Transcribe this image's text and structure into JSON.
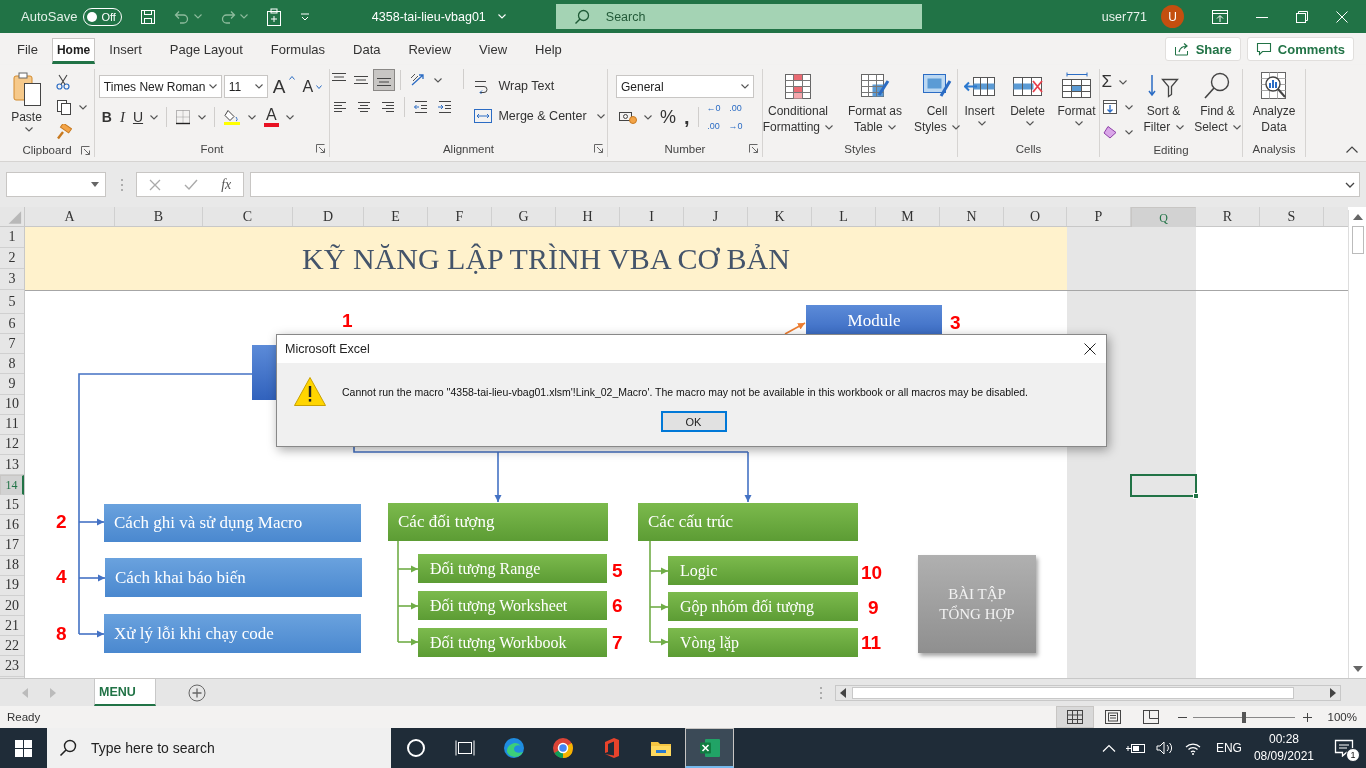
{
  "title_bar": {
    "autosave_label": "AutoSave",
    "autosave": {
      "label": "Off",
      "on": false
    },
    "file_name": "4358-tai-lieu-vbag01",
    "search_placeholder": "Search",
    "user_name": "user771",
    "avatar_initial": "U"
  },
  "ribbon_tabs": [
    {
      "label": "File",
      "selected": false
    },
    {
      "label": "Home",
      "selected": true
    },
    {
      "label": "Insert",
      "selected": false
    },
    {
      "label": "Page Layout",
      "selected": false
    },
    {
      "label": "Formulas",
      "selected": false
    },
    {
      "label": "Data",
      "selected": false
    },
    {
      "label": "Review",
      "selected": false
    },
    {
      "label": "View",
      "selected": false
    },
    {
      "label": "Help",
      "selected": false
    }
  ],
  "share_button": "Share",
  "comments_button": "Comments",
  "ribbon": {
    "clipboard": {
      "label": "Clipboard",
      "launcher": true,
      "paste": "Paste"
    },
    "font": {
      "label": "Font",
      "launcher": true,
      "font_name": "Times New Roman",
      "font_size": "11",
      "grow": "A",
      "shrink": "A",
      "bold": "B",
      "italic": "I",
      "underline": "U",
      "font_color": "A"
    },
    "alignment": {
      "label": "Alignment",
      "launcher": true,
      "vertical": [
        {
          "selected": false
        },
        {
          "selected": false
        },
        {
          "selected": true
        }
      ],
      "wrap_text": "Wrap Text",
      "merge_center": "Merge & Center"
    },
    "number": {
      "label": "Number",
      "launcher": true,
      "format": "General",
      "percent": "%",
      "comma": ",",
      "increase_decimal": [
        "←0",
        ".00"
      ],
      "decrease_decimal": [
        ".00",
        "→0"
      ]
    },
    "styles": {
      "label": "Styles",
      "buttons": [
        "Conditional Formatting",
        "Format as Table",
        "Cell Styles"
      ]
    },
    "cells": {
      "label": "Cells",
      "buttons": [
        "Insert",
        "Delete",
        "Format"
      ]
    },
    "editing": {
      "label": "Editing",
      "sum": "Σ",
      "buttons": [
        "Sort & Filter",
        "Find & Select"
      ]
    },
    "analysis": {
      "label": "Analysis",
      "buttons": [
        "Analyze Data"
      ]
    }
  },
  "formula_bar": {
    "fx": "fx"
  },
  "sheet": {
    "columns": [
      {
        "label": "A",
        "selected": false
      },
      {
        "label": "B",
        "selected": false
      },
      {
        "label": "C",
        "selected": false
      },
      {
        "label": "D",
        "selected": false
      },
      {
        "label": "E",
        "selected": false
      },
      {
        "label": "F",
        "selected": false
      },
      {
        "label": "G",
        "selected": false
      },
      {
        "label": "H",
        "selected": false
      },
      {
        "label": "I",
        "selected": false
      },
      {
        "label": "J",
        "selected": false
      },
      {
        "label": "K",
        "selected": false
      },
      {
        "label": "L",
        "selected": false
      },
      {
        "label": "M",
        "selected": false
      },
      {
        "label": "N",
        "selected": false
      },
      {
        "label": "O",
        "selected": false
      },
      {
        "label": "P",
        "selected": false
      },
      {
        "label": "Q",
        "selected": true
      },
      {
        "label": "R",
        "selected": false
      },
      {
        "label": "S",
        "selected": false
      }
    ],
    "rows": [
      {
        "label": "1",
        "selected": false
      },
      {
        "label": "2",
        "selected": false
      },
      {
        "label": "3",
        "selected": false
      },
      {
        "label": "5",
        "selected": false
      },
      {
        "label": "6",
        "selected": false
      },
      {
        "label": "7",
        "selected": false
      },
      {
        "label": "8",
        "selected": false
      },
      {
        "label": "9",
        "selected": false
      },
      {
        "label": "10",
        "selected": false
      },
      {
        "label": "11",
        "selected": false
      },
      {
        "label": "12",
        "selected": false
      },
      {
        "label": "13",
        "selected": false
      },
      {
        "label": "14",
        "selected": true
      },
      {
        "label": "15",
        "selected": false
      },
      {
        "label": "16",
        "selected": false
      },
      {
        "label": "17",
        "selected": false
      },
      {
        "label": "18",
        "selected": false
      },
      {
        "label": "19",
        "selected": false
      },
      {
        "label": "20",
        "selected": false
      },
      {
        "label": "21",
        "selected": false
      },
      {
        "label": "22",
        "selected": false
      },
      {
        "label": "23",
        "selected": false
      }
    ],
    "title": "KỸ NĂNG LẬP TRÌNH VBA CƠ BẢN",
    "shapes": [
      {
        "kind": "navy",
        "text": "Module"
      },
      {
        "kind": "navy"
      },
      {
        "kind": "blue",
        "text": "Cách ghi và sử dụng Macro"
      },
      {
        "kind": "blue",
        "text": "Cách khai báo biến"
      },
      {
        "kind": "blue",
        "text": "Xử lý lỗi khi chạy code"
      },
      {
        "kind": "green_header",
        "text": "Các đối tượng"
      },
      {
        "kind": "green",
        "text": "Đối tượng Range"
      },
      {
        "kind": "green",
        "text": "Đối tượng Worksheet"
      },
      {
        "kind": "green",
        "text": "Đối tượng Workbook"
      },
      {
        "kind": "green_header",
        "text": "Các cấu trúc"
      },
      {
        "kind": "green",
        "text": "Logic"
      },
      {
        "kind": "green",
        "text": "Gộp nhóm đối tượng"
      },
      {
        "kind": "green",
        "text": "Vòng lặp"
      },
      {
        "kind": "grey",
        "text": "BÀI TẬP TỔNG HỢP"
      }
    ],
    "step_numbers": [
      "1",
      "3",
      "2",
      "4",
      "8",
      "5",
      "6",
      "7",
      "10",
      "9",
      "11"
    ]
  },
  "dialog": {
    "title": "Microsoft Excel",
    "message": "Cannot run the macro ''4358-tai-lieu-vbag01.xlsm'!Link_02_Macro'. The macro may not be available in this workbook or all macros may be disabled.",
    "ok_button": "OK"
  },
  "sheet_tabs": [
    {
      "label": "MENU",
      "selected": true
    }
  ],
  "status_bar": {
    "status": "Ready",
    "views": [
      {
        "kind": "normal",
        "selected": true
      },
      {
        "kind": "page_layout",
        "selected": false
      },
      {
        "kind": "page_break",
        "selected": false
      }
    ],
    "zoom": {
      "level": 0.5
    },
    "zoom_label": "100%"
  },
  "taskbar": {
    "search_placeholder": "Type here to search",
    "apps": [
      {
        "kind": "cortana",
        "selected": false
      },
      {
        "kind": "task_view",
        "selected": false
      },
      {
        "kind": "edge",
        "selected": false
      },
      {
        "kind": "chrome",
        "selected": false
      },
      {
        "kind": "office",
        "selected": false
      },
      {
        "kind": "explorer",
        "selected": false
      },
      {
        "kind": "excel",
        "selected": true
      }
    ],
    "language": "ENG",
    "time": "00:28",
    "date": "08/09/2021",
    "notification_count": "1"
  }
}
